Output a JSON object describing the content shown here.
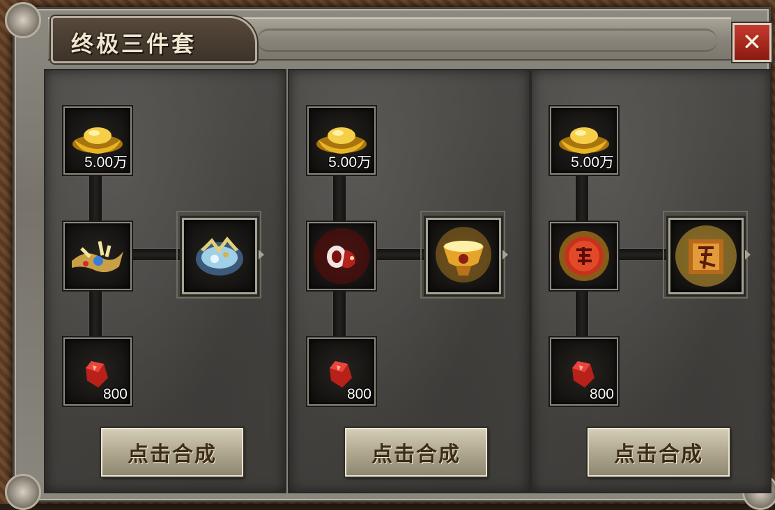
{
  "window": {
    "title": "终极三件套",
    "close_label": "✕"
  },
  "panels": [
    {
      "gold_qty": "5.00万",
      "ingredient_icon": "golden-ornate-ring-icon",
      "result_icon": "jeweled-crown-icon",
      "gem_qty": "800",
      "craft_label": "点击合成"
    },
    {
      "gold_qty": "5.00万",
      "ingredient_icon": "red-dragon-ring-icon",
      "result_icon": "golden-goblet-icon",
      "gem_qty": "800",
      "craft_label": "点击合成"
    },
    {
      "gold_qty": "5.00万",
      "ingredient_icon": "soul-orb-icon",
      "result_icon": "glowing-rune-icon",
      "gem_qty": "800",
      "craft_label": "点击合成"
    }
  ],
  "colors": {
    "accent_red": "#c53a2c",
    "gold": "#e8b424",
    "gem_red": "#c8221c"
  }
}
